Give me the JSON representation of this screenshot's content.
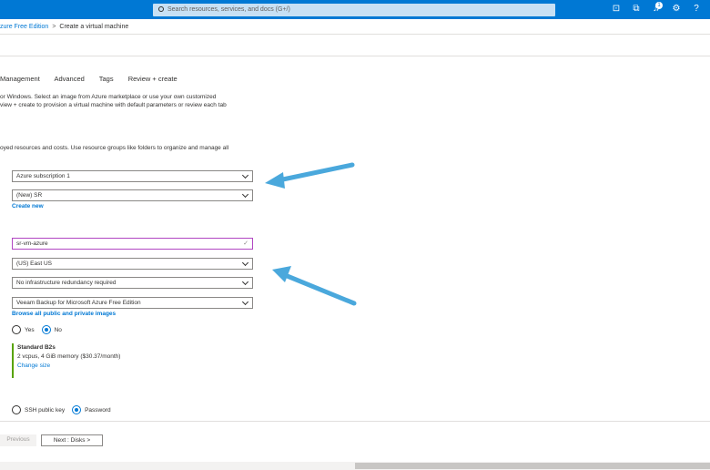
{
  "topbar": {
    "search_placeholder": "Search resources, services, and docs (G+/)",
    "notification_count": "1",
    "icons": [
      "terminal-icon",
      "directory-filter-icon",
      "notifications-icon",
      "settings-icon",
      "help-icon"
    ]
  },
  "breadcrumb": {
    "parent": "zure Free Edition",
    "separator": ">",
    "current": "Create a virtual machine"
  },
  "tabs": [
    "Management",
    "Advanced",
    "Tags",
    "Review + create"
  ],
  "intro_text": {
    "line1": "or Windows. Select an image from Azure marketplace or use your own customized",
    "line2": "view + create to provision a virtual machine with default parameters or review each tab"
  },
  "resource_text": "oyed resources and costs. Use resource groups like folders to organize and manage all",
  "fields": {
    "subscription": "Azure subscription 1",
    "resource_group": "(New) SR",
    "create_new": "Create new",
    "vm_name": "sr-vm-azure",
    "vm_name_check": "✓",
    "region": "(US) East US",
    "availability": "No infrastructure redundancy required",
    "image": "Veeam Backup for Microsoft Azure Free Edition",
    "browse_images": "Browse all public and private images"
  },
  "spot": {
    "yes": "Yes",
    "no": "No",
    "selected": "No"
  },
  "size": {
    "name": "Standard B2s",
    "details": "2 vcpus, 4 GiB memory ($30.37/month)",
    "change": "Change size"
  },
  "auth": {
    "ssh": "SSH public key",
    "password": "Password",
    "selected": "Password"
  },
  "footer": {
    "previous": "Previous",
    "next": "Next : Disks >"
  },
  "colors": {
    "topbar": "#0078d4",
    "link": "#0078d4",
    "arrow": "#4aa8dc",
    "size_accent": "#57a300"
  }
}
